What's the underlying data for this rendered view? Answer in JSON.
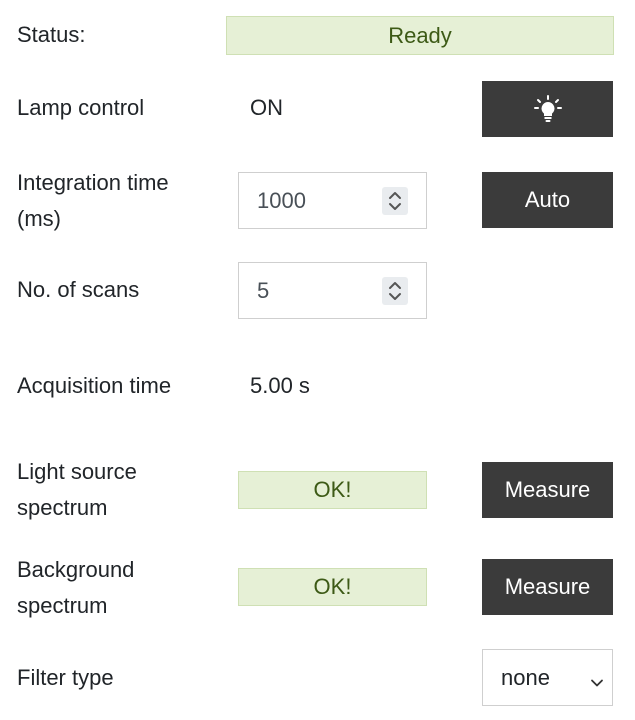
{
  "status": {
    "label": "Status:",
    "value": "Ready"
  },
  "lamp": {
    "label": "Lamp control",
    "value": "ON",
    "button_icon": "lightbulb-icon"
  },
  "integration": {
    "label_line1": "Integration time",
    "label_line2": "(ms)",
    "value": "1000",
    "auto_label": "Auto"
  },
  "scans": {
    "label": "No. of scans",
    "value": "5"
  },
  "acquisition": {
    "label": "Acquisition time",
    "value": "5.00 s"
  },
  "light_source": {
    "label_line1": "Light source",
    "label_line2": "spectrum",
    "status": "OK!",
    "button": "Measure"
  },
  "background": {
    "label_line1": "Background",
    "label_line2": "spectrum",
    "status": "OK!",
    "button": "Measure"
  },
  "filter": {
    "label": "Filter type",
    "selected": "none"
  },
  "colors": {
    "status_bg": "#e6f0d6",
    "status_text": "#3d5a16",
    "button_bg": "#3b3b3b"
  }
}
